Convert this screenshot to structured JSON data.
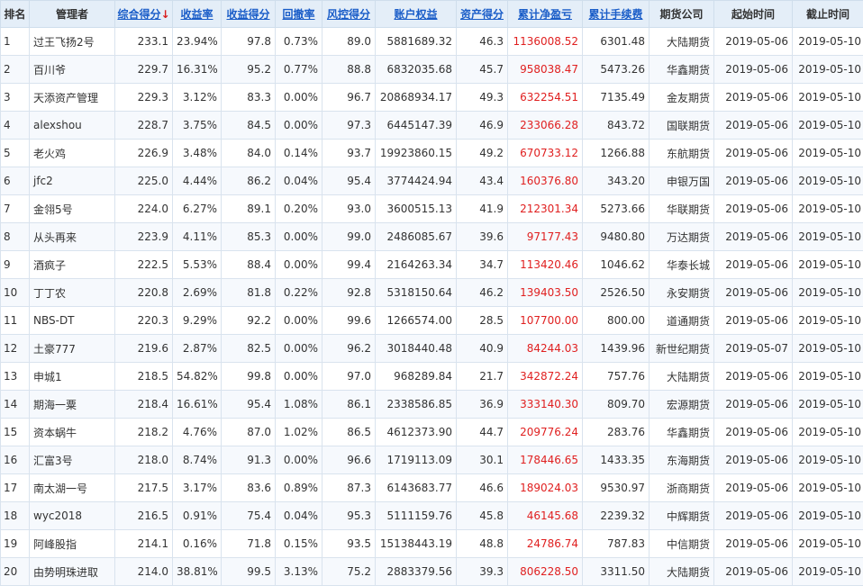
{
  "header": {
    "rank": "排名",
    "manager": "管理者",
    "total_score": "综合得分",
    "sort_indicator": "↓",
    "return_rate": "收益率",
    "return_score": "收益得分",
    "drawdown": "回撤率",
    "risk_score": "风控得分",
    "equity": "账户权益",
    "asset_score": "资产得分",
    "cum_pnl": "累计净盈亏",
    "cum_fee": "累计手续费",
    "company": "期货公司",
    "start": "起始时间",
    "end": "截止时间"
  },
  "rows": [
    {
      "rank": "1",
      "manager": "过王飞扬2号",
      "total": "233.1",
      "ret": "23.94%",
      "ret_score": "97.8",
      "dd": "0.73%",
      "risk": "89.0",
      "equity": "5881689.32",
      "asset": "46.3",
      "pnl": "1136008.52",
      "fee": "6301.48",
      "company": "大陆期货",
      "start": "2019-05-06",
      "end": "2019-05-10"
    },
    {
      "rank": "2",
      "manager": "百川爷",
      "total": "229.7",
      "ret": "16.31%",
      "ret_score": "95.2",
      "dd": "0.77%",
      "risk": "88.8",
      "equity": "6832035.68",
      "asset": "45.7",
      "pnl": "958038.47",
      "fee": "5473.26",
      "company": "华鑫期货",
      "start": "2019-05-06",
      "end": "2019-05-10"
    },
    {
      "rank": "3",
      "manager": "天添资产管理",
      "total": "229.3",
      "ret": "3.12%",
      "ret_score": "83.3",
      "dd": "0.00%",
      "risk": "96.7",
      "equity": "20868934.17",
      "asset": "49.3",
      "pnl": "632254.51",
      "fee": "7135.49",
      "company": "金友期货",
      "start": "2019-05-06",
      "end": "2019-05-10"
    },
    {
      "rank": "4",
      "manager": "alexshou",
      "total": "228.7",
      "ret": "3.75%",
      "ret_score": "84.5",
      "dd": "0.00%",
      "risk": "97.3",
      "equity": "6445147.39",
      "asset": "46.9",
      "pnl": "233066.28",
      "fee": "843.72",
      "company": "国联期货",
      "start": "2019-05-06",
      "end": "2019-05-10"
    },
    {
      "rank": "5",
      "manager": "老火鸡",
      "total": "226.9",
      "ret": "3.48%",
      "ret_score": "84.0",
      "dd": "0.14%",
      "risk": "93.7",
      "equity": "19923860.15",
      "asset": "49.2",
      "pnl": "670733.12",
      "fee": "1266.88",
      "company": "东航期货",
      "start": "2019-05-06",
      "end": "2019-05-10"
    },
    {
      "rank": "6",
      "manager": "jfc2",
      "total": "225.0",
      "ret": "4.44%",
      "ret_score": "86.2",
      "dd": "0.04%",
      "risk": "95.4",
      "equity": "3774424.94",
      "asset": "43.4",
      "pnl": "160376.80",
      "fee": "343.20",
      "company": "申银万国",
      "start": "2019-05-06",
      "end": "2019-05-10"
    },
    {
      "rank": "7",
      "manager": "金翎5号",
      "total": "224.0",
      "ret": "6.27%",
      "ret_score": "89.1",
      "dd": "0.20%",
      "risk": "93.0",
      "equity": "3600515.13",
      "asset": "41.9",
      "pnl": "212301.34",
      "fee": "5273.66",
      "company": "华联期货",
      "start": "2019-05-06",
      "end": "2019-05-10"
    },
    {
      "rank": "8",
      "manager": "从头再来",
      "total": "223.9",
      "ret": "4.11%",
      "ret_score": "85.3",
      "dd": "0.00%",
      "risk": "99.0",
      "equity": "2486085.67",
      "asset": "39.6",
      "pnl": "97177.43",
      "fee": "9480.80",
      "company": "万达期货",
      "start": "2019-05-06",
      "end": "2019-05-10"
    },
    {
      "rank": "9",
      "manager": "酒疯子",
      "total": "222.5",
      "ret": "5.53%",
      "ret_score": "88.4",
      "dd": "0.00%",
      "risk": "99.4",
      "equity": "2164263.34",
      "asset": "34.7",
      "pnl": "113420.46",
      "fee": "1046.62",
      "company": "华泰长城",
      "start": "2019-05-06",
      "end": "2019-05-10"
    },
    {
      "rank": "10",
      "manager": "丁丁农",
      "total": "220.8",
      "ret": "2.69%",
      "ret_score": "81.8",
      "dd": "0.22%",
      "risk": "92.8",
      "equity": "5318150.64",
      "asset": "46.2",
      "pnl": "139403.50",
      "fee": "2526.50",
      "company": "永安期货",
      "start": "2019-05-06",
      "end": "2019-05-10"
    },
    {
      "rank": "11",
      "manager": "NBS-DT",
      "total": "220.3",
      "ret": "9.29%",
      "ret_score": "92.2",
      "dd": "0.00%",
      "risk": "99.6",
      "equity": "1266574.00",
      "asset": "28.5",
      "pnl": "107700.00",
      "fee": "800.00",
      "company": "道通期货",
      "start": "2019-05-06",
      "end": "2019-05-10"
    },
    {
      "rank": "12",
      "manager": "土豪777",
      "total": "219.6",
      "ret": "2.87%",
      "ret_score": "82.5",
      "dd": "0.00%",
      "risk": "96.2",
      "equity": "3018440.48",
      "asset": "40.9",
      "pnl": "84244.03",
      "fee": "1439.96",
      "company": "新世纪期货",
      "start": "2019-05-07",
      "end": "2019-05-10"
    },
    {
      "rank": "13",
      "manager": "申城1",
      "total": "218.5",
      "ret": "54.82%",
      "ret_score": "99.8",
      "dd": "0.00%",
      "risk": "97.0",
      "equity": "968289.84",
      "asset": "21.7",
      "pnl": "342872.24",
      "fee": "757.76",
      "company": "大陆期货",
      "start": "2019-05-06",
      "end": "2019-05-10"
    },
    {
      "rank": "14",
      "manager": "期海一粟",
      "total": "218.4",
      "ret": "16.61%",
      "ret_score": "95.4",
      "dd": "1.08%",
      "risk": "86.1",
      "equity": "2338586.85",
      "asset": "36.9",
      "pnl": "333140.30",
      "fee": "809.70",
      "company": "宏源期货",
      "start": "2019-05-06",
      "end": "2019-05-10"
    },
    {
      "rank": "15",
      "manager": "资本蜗牛",
      "total": "218.2",
      "ret": "4.76%",
      "ret_score": "87.0",
      "dd": "1.02%",
      "risk": "86.5",
      "equity": "4612373.90",
      "asset": "44.7",
      "pnl": "209776.24",
      "fee": "283.76",
      "company": "华鑫期货",
      "start": "2019-05-06",
      "end": "2019-05-10"
    },
    {
      "rank": "16",
      "manager": "汇富3号",
      "total": "218.0",
      "ret": "8.74%",
      "ret_score": "91.3",
      "dd": "0.00%",
      "risk": "96.6",
      "equity": "1719113.09",
      "asset": "30.1",
      "pnl": "178446.65",
      "fee": "1433.35",
      "company": "东海期货",
      "start": "2019-05-06",
      "end": "2019-05-10"
    },
    {
      "rank": "17",
      "manager": "南太湖一号",
      "total": "217.5",
      "ret": "3.17%",
      "ret_score": "83.6",
      "dd": "0.89%",
      "risk": "87.3",
      "equity": "6143683.77",
      "asset": "46.6",
      "pnl": "189024.03",
      "fee": "9530.97",
      "company": "浙商期货",
      "start": "2019-05-06",
      "end": "2019-05-10"
    },
    {
      "rank": "18",
      "manager": "wyc2018",
      "total": "216.5",
      "ret": "0.91%",
      "ret_score": "75.4",
      "dd": "0.04%",
      "risk": "95.3",
      "equity": "5111159.76",
      "asset": "45.8",
      "pnl": "46145.68",
      "fee": "2239.32",
      "company": "中辉期货",
      "start": "2019-05-06",
      "end": "2019-05-10"
    },
    {
      "rank": "19",
      "manager": "阿峰股指",
      "total": "214.1",
      "ret": "0.16%",
      "ret_score": "71.8",
      "dd": "0.15%",
      "risk": "93.5",
      "equity": "15138443.19",
      "asset": "48.8",
      "pnl": "24786.74",
      "fee": "787.83",
      "company": "中信期货",
      "start": "2019-05-06",
      "end": "2019-05-10"
    },
    {
      "rank": "20",
      "manager": "由势明珠进取",
      "total": "214.0",
      "ret": "38.81%",
      "ret_score": "99.5",
      "dd": "3.13%",
      "risk": "75.2",
      "equity": "2883379.56",
      "asset": "39.3",
      "pnl": "806228.50",
      "fee": "3311.50",
      "company": "大陆期货",
      "start": "2019-05-06",
      "end": "2019-05-10"
    }
  ],
  "colors": {
    "header_bg": "#e4eef8",
    "link": "#1a5dc8",
    "pnl_positive": "#e02020",
    "sort_arrow": "#d81e1e"
  }
}
